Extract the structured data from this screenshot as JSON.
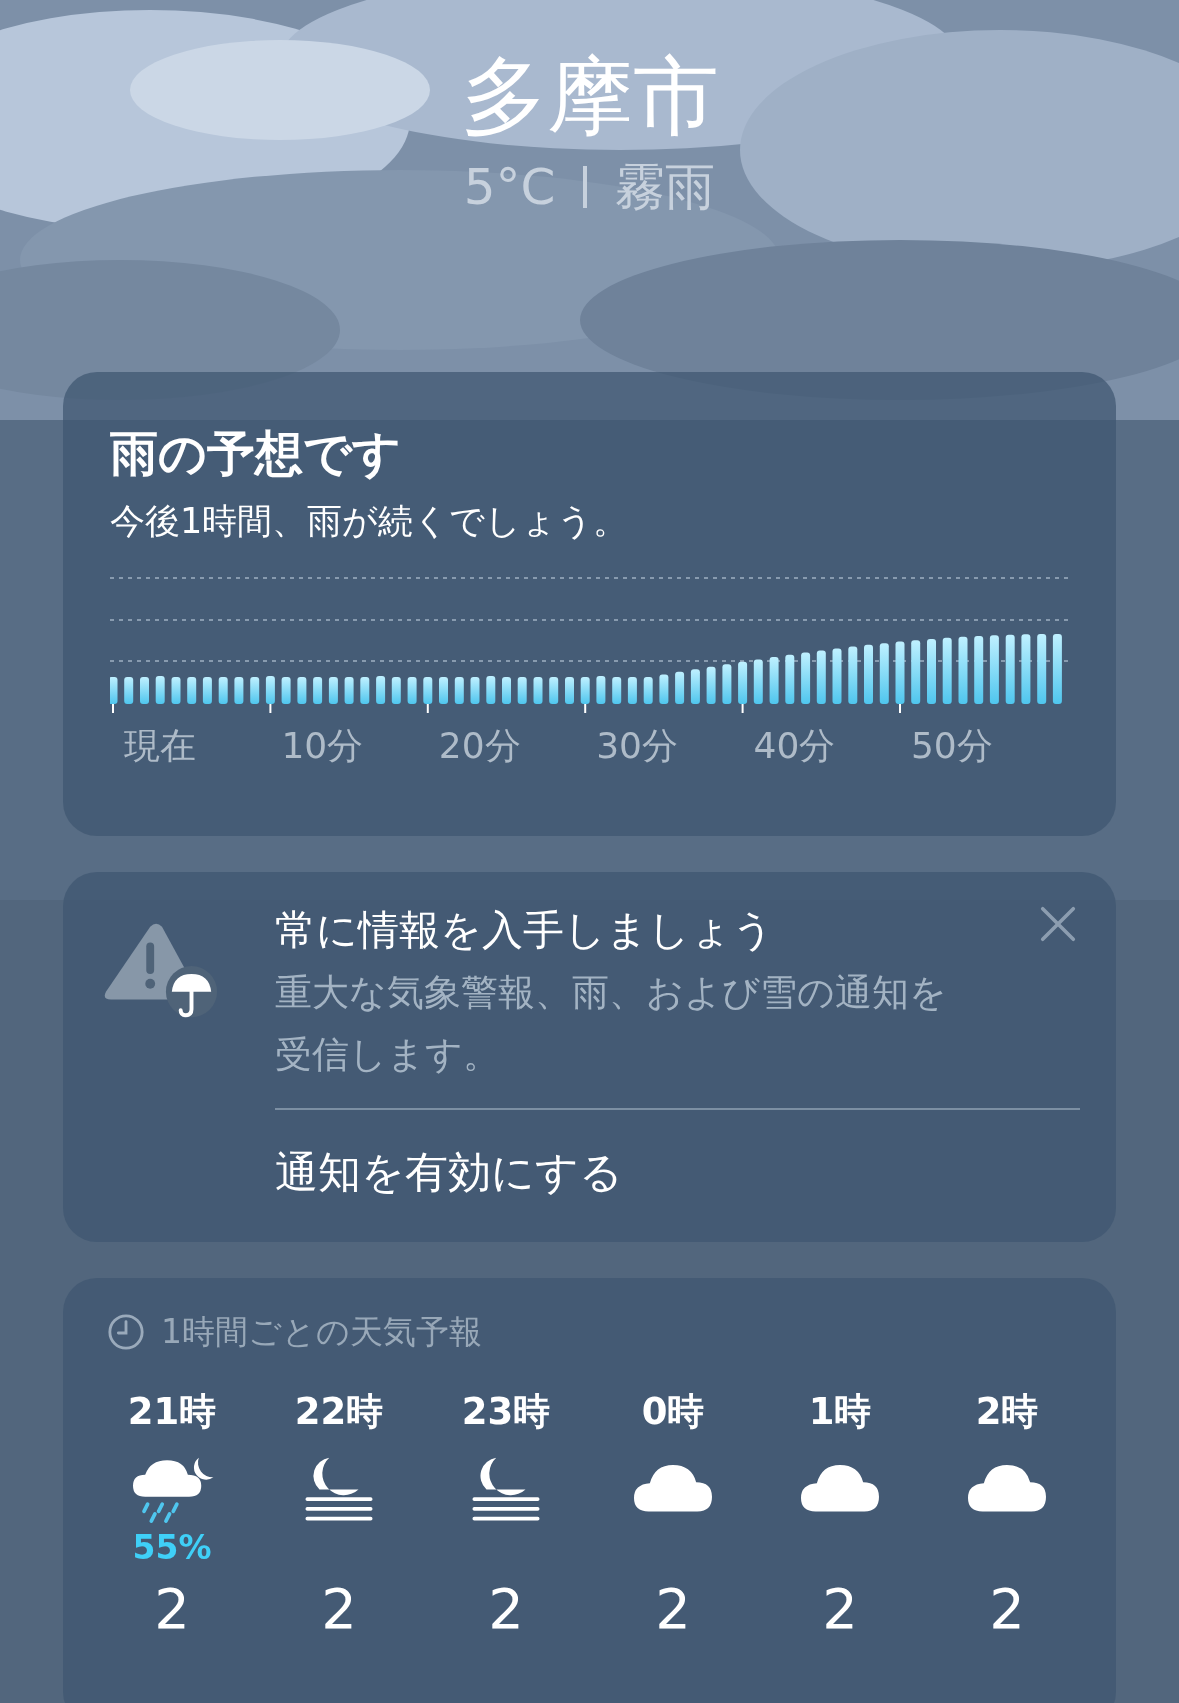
{
  "location": {
    "city": "多摩市",
    "temperature": "5°C",
    "condition": "霧雨"
  },
  "precipitation": {
    "title": "雨の予想です",
    "summary": "今後1時間、雨が続くでしょう。",
    "axis_labels": [
      "現在",
      "10分",
      "20分",
      "30分",
      "40分",
      "50分"
    ]
  },
  "notification_prompt": {
    "title": "常に情報を入手しましょう",
    "description": "重大な気象警報、雨、および雪の通知を受信します。",
    "action": "通知を有効にする"
  },
  "hourly": {
    "header": "1時間ごとの天気予報",
    "hours": [
      {
        "time": "21時",
        "kind": "rain-moon",
        "chance": "55%",
        "temp": "2"
      },
      {
        "time": "22時",
        "kind": "moon-fog",
        "temp": "2"
      },
      {
        "time": "23時",
        "kind": "moon-fog",
        "temp": "2"
      },
      {
        "time": "0時",
        "kind": "cloud",
        "temp": "2"
      },
      {
        "time": "1時",
        "kind": "cloud",
        "temp": "2"
      },
      {
        "time": "2時",
        "kind": "cloud",
        "temp": "2"
      }
    ]
  }
}
